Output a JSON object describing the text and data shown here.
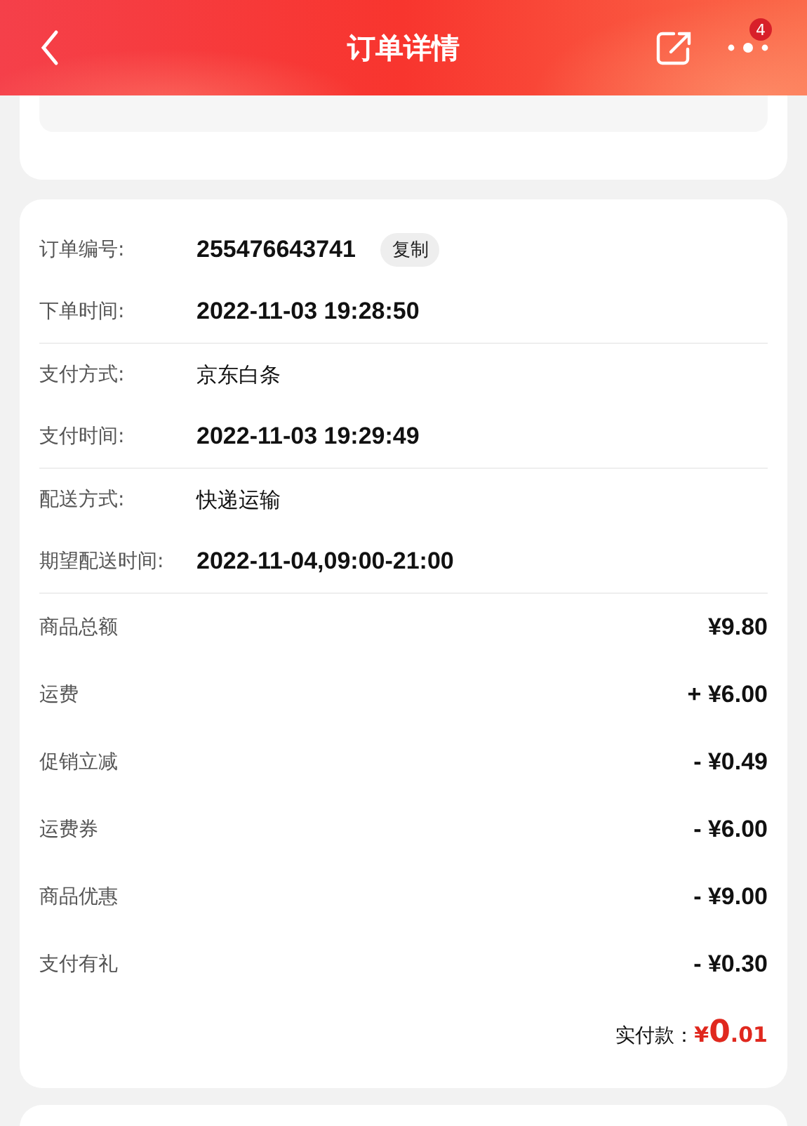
{
  "header": {
    "title": "订单详情",
    "notification_count": "4"
  },
  "order_info": [
    {
      "label": "订单编号:",
      "value": "255476643741",
      "kind": "number",
      "copy_button": "复制",
      "divider_after": false
    },
    {
      "label": "下单时间:",
      "value": "2022-11-03 19:28:50",
      "kind": "number",
      "divider_after": true
    },
    {
      "label": "支付方式:",
      "value": "京东白条",
      "kind": "text",
      "divider_after": false
    },
    {
      "label": "支付时间:",
      "value": "2022-11-03 19:29:49",
      "kind": "number",
      "divider_after": true
    },
    {
      "label": "配送方式:",
      "value": "快递运输",
      "kind": "text",
      "divider_after": false
    },
    {
      "label": "期望配送时间:",
      "value": "2022-11-04,09:00-21:00",
      "kind": "number",
      "divider_after": true
    }
  ],
  "price_lines": [
    {
      "label": "商品总额",
      "amount": "¥9.80"
    },
    {
      "label": "运费",
      "amount": "+ ¥6.00"
    },
    {
      "label": "促销立减",
      "amount": "- ¥0.49"
    },
    {
      "label": "运费券",
      "amount": "- ¥6.00"
    },
    {
      "label": "商品优惠",
      "amount": "- ¥9.00"
    },
    {
      "label": "支付有礼",
      "amount": "- ¥0.30"
    }
  ],
  "total": {
    "label": "实付款：",
    "currency": "¥",
    "integer": "0",
    "decimal": ".01"
  }
}
